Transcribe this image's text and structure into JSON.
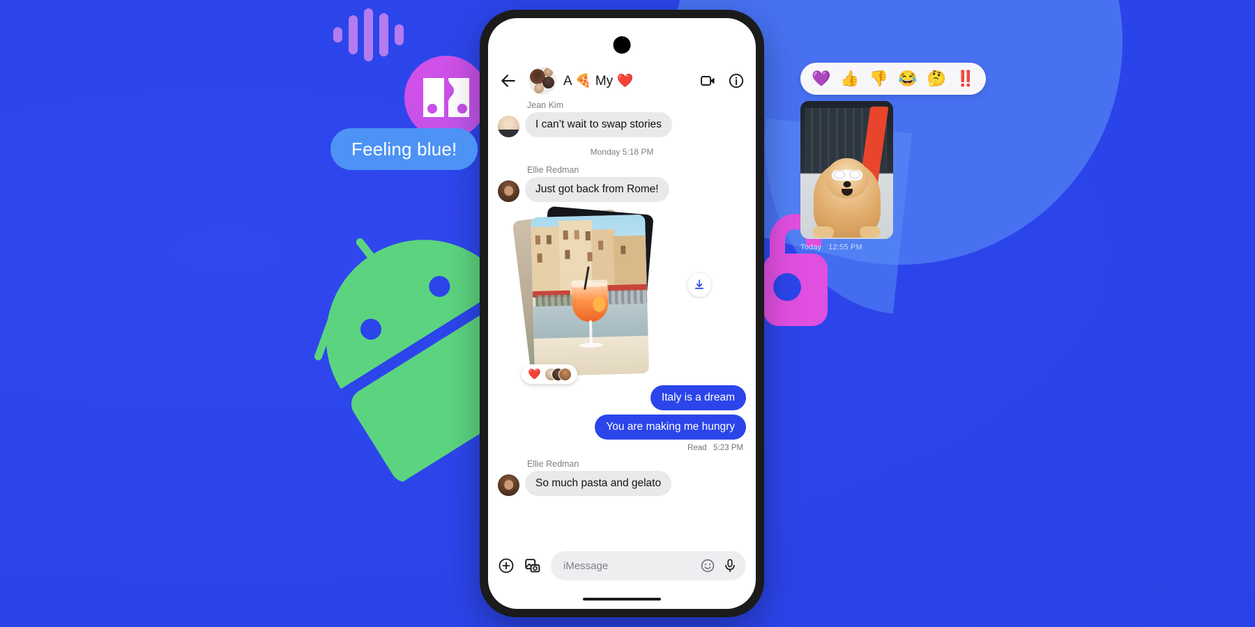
{
  "scene": {
    "background_color": "#2b45ea",
    "brand_accent": "#2b45ea"
  },
  "decorations": {
    "waveform": {
      "name": "voice-waveform",
      "bars": [
        22,
        56,
        76,
        62,
        30
      ],
      "color": "#b47cf0"
    },
    "sticker_circle": {
      "name": "sticker-badge",
      "color": "#c751e8"
    },
    "android_robot": {
      "name": "android-mascot",
      "color": "#5cd47f"
    },
    "lock": {
      "name": "padlock",
      "color": "#e04fe0"
    },
    "speech_blob": {
      "name": "speech-bubble-shape",
      "color": "#5a8cf6"
    }
  },
  "floating_bubble": {
    "name": "feeling-blue-bubble",
    "text": "Feeling blue!",
    "color": "#4d93f5"
  },
  "reaction_bar": {
    "name": "emoji-reaction-bar",
    "emojis": [
      "💜",
      "👍",
      "👎",
      "😂",
      "🤔",
      "‼️"
    ],
    "labels": [
      "heart-emoji",
      "thumbs-up-emoji",
      "thumbs-down-emoji",
      "laughing-emoji",
      "thinking-emoji",
      "double-exclamation-emoji"
    ]
  },
  "dog_card": {
    "name": "dog-photo-card",
    "caption_day": "Today",
    "caption_time": "12:55 PM",
    "alt": "chow chow dog wearing white sunglasses"
  },
  "phone": {
    "header": {
      "back_icon": "back-arrow-icon",
      "title": "A 🍕 My ❤️",
      "title_plain": "A My",
      "title_emoji_1": "🍕",
      "title_emoji_2": "❤️",
      "video_icon": "video-call-icon",
      "info_icon": "info-icon",
      "avatar": "group-avatar"
    },
    "messages": [
      {
        "type": "incoming",
        "sender": "Jean Kim",
        "text": "I can’t wait to swap stories"
      },
      {
        "type": "divider",
        "text": "Monday  5:18 PM"
      },
      {
        "type": "incoming",
        "sender": "Ellie Redman",
        "text": "Just got back from Rome!"
      },
      {
        "type": "photo-stack",
        "alt": "Aperol spritz in Italian piazza",
        "reaction": "❤️",
        "reaction_count_faces": 3,
        "download_icon": "download-icon"
      },
      {
        "type": "outgoing",
        "text": "Italy is a dream"
      },
      {
        "type": "outgoing",
        "text": "You are making me hungry",
        "status": "Read",
        "status_time": "5:23 PM"
      },
      {
        "type": "incoming",
        "sender": "Ellie Redman",
        "text": "So much pasta and gelato"
      }
    ],
    "compose": {
      "plus_icon": "add-attachment-icon",
      "gallery_icon": "photo-gallery-icon",
      "placeholder": "iMessage",
      "value": "",
      "emoji_icon": "emoji-picker-icon",
      "mic_icon": "microphone-icon"
    }
  }
}
